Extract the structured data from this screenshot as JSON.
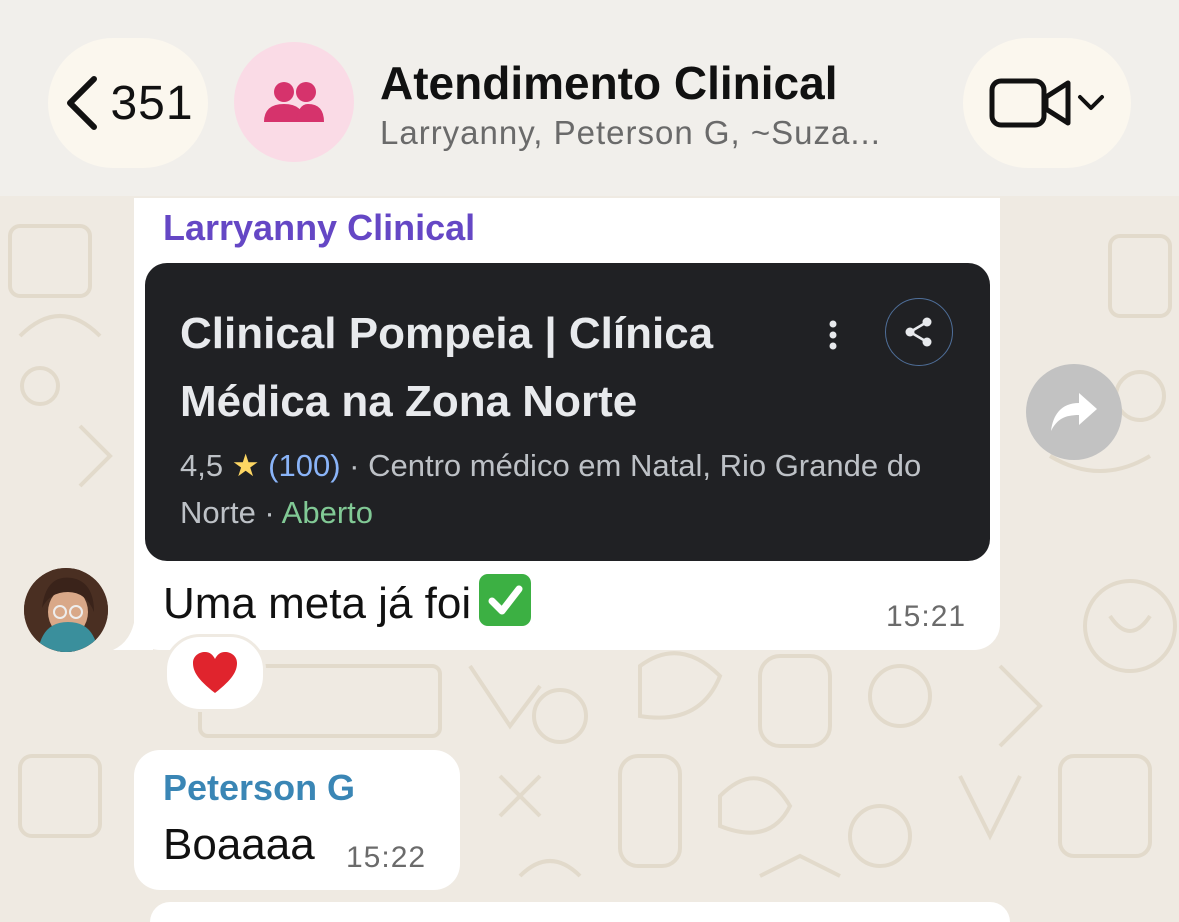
{
  "header": {
    "back_count": "351",
    "title": "Atendimento Clinical",
    "subtitle": "Larryanny, Peterson G, ~Suza...",
    "group_avatar_color": "#d6336c",
    "icons": [
      "chevron-left-icon",
      "group-icon",
      "video-camera-icon",
      "chevron-down-icon"
    ]
  },
  "messages": [
    {
      "sender": "Larryanny Clinical",
      "sender_color": "#6547c5",
      "link_preview": {
        "title": "Clinical Pompeia | Clínica Médica na Zona Norte",
        "rating": "4,5",
        "star": "★",
        "rating_count": "(100)",
        "category": "· Centro médico em Natal, Rio Grande do Norte ·",
        "status": "Aberto"
      },
      "text": "Uma meta já foi",
      "emoji": "check-mark-button-icon",
      "time": "15:21",
      "reaction": "heart-icon"
    },
    {
      "sender": "Peterson G",
      "sender_color": "#3a86b5",
      "text": "Boaaaa",
      "time": "15:22"
    }
  ]
}
